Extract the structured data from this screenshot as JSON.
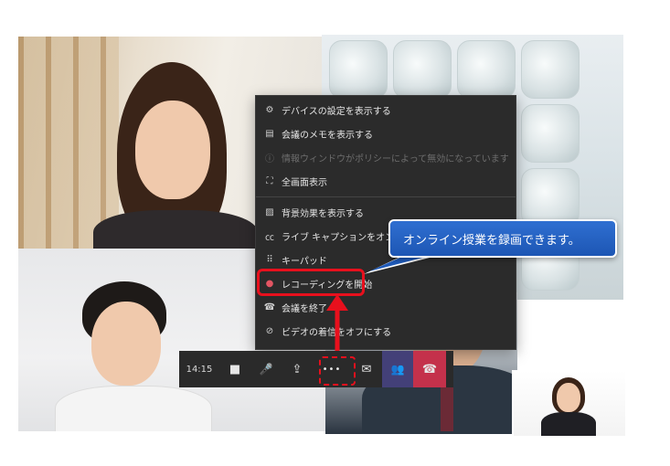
{
  "menu": {
    "items": [
      {
        "label": "デバイスの設定を表示する",
        "icon": "gear-icon",
        "glyph": "⚙",
        "disabled": false
      },
      {
        "label": "会議のメモを表示する",
        "icon": "notes-icon",
        "glyph": "▤",
        "disabled": false
      },
      {
        "label": "情報ウィンドウがポリシーによって無効になっています",
        "icon": "info-icon",
        "glyph": "ⓘ",
        "disabled": true
      },
      {
        "label": "全画面表示",
        "icon": "fullscreen-icon",
        "glyph": "⛶",
        "disabled": false
      },
      {
        "label": "背景効果を表示する",
        "icon": "background-effects-icon",
        "glyph": "▨",
        "disabled": false
      },
      {
        "label": "ライブ キャプションをオンにする",
        "icon": "captions-icon",
        "glyph": "㏄",
        "disabled": false
      },
      {
        "label": "キーパッド",
        "icon": "keypad-icon",
        "glyph": "⠿",
        "disabled": false
      },
      {
        "label": "レコーディングを開始",
        "icon": "record-icon",
        "glyph": "●",
        "disabled": false
      },
      {
        "label": "会議を終了",
        "icon": "end-meeting-icon",
        "glyph": "☎",
        "disabled": false
      },
      {
        "label": "ビデオの着信をオフにする",
        "icon": "video-off-icon",
        "glyph": "⊘",
        "disabled": false
      }
    ]
  },
  "callout": {
    "text": "オンライン授業を録画できます。"
  },
  "toolbar": {
    "time": "14:15",
    "camera_icon": "■",
    "mic_icon": "🎤",
    "share_icon": "⇪",
    "more_label": "•••",
    "chat_icon": "✉",
    "participants_icon": "👥",
    "hangup_icon": "☎"
  },
  "colors": {
    "highlight": "#e8101d",
    "callout": "#2f6fd1",
    "menu_bg": "#2b2b2b",
    "hangup": "#c4314b",
    "participants": "#434078"
  }
}
